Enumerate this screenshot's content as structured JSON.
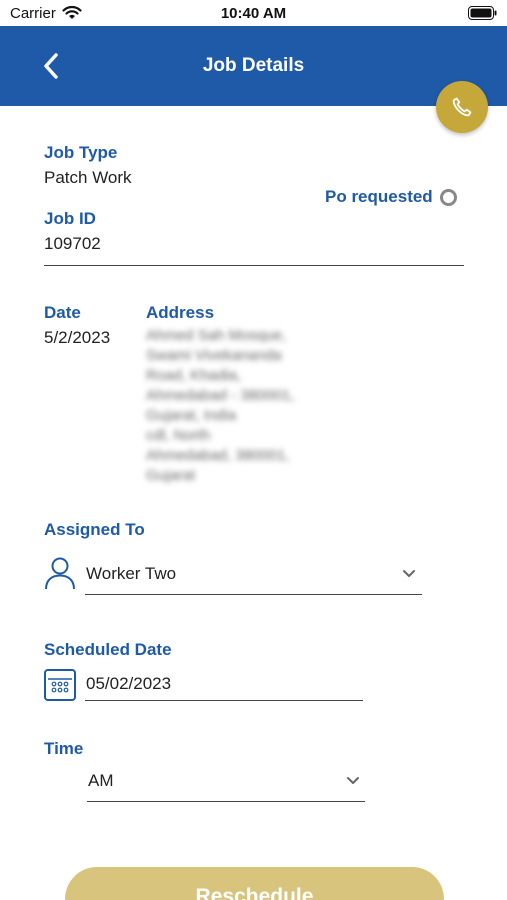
{
  "status_bar": {
    "carrier": "Carrier",
    "time": "10:40 AM"
  },
  "header": {
    "title": "Job Details"
  },
  "job": {
    "type_label": "Job Type",
    "type_value": "Patch Work",
    "id_label": "Job ID",
    "id_value": "109702",
    "po_label": "Po requested",
    "date_label": "Date",
    "date_value": "5/2/2023",
    "address_label": "Address",
    "address_lines": [
      "Ahmed Sah Mosque,",
      "Swami Vivekananda",
      "Road, Khadia,",
      "Ahmedabad - 380001,",
      "Gujarat, India",
      "cdl, North",
      "Ahmedabad, 380001,",
      "Gujarat"
    ]
  },
  "assigned": {
    "label": "Assigned To",
    "value": "Worker Two"
  },
  "scheduled": {
    "label": "Scheduled Date",
    "value": "05/02/2023"
  },
  "time": {
    "label": "Time",
    "value": "AM"
  },
  "actions": {
    "reschedule_label": "Reschedule"
  },
  "colors": {
    "primary": "#1f5aa8",
    "accent_gold": "#c6a739",
    "button_gold": "#d9c47e"
  },
  "icons": [
    "back-arrow-icon",
    "phone-icon",
    "user-icon",
    "calendar-icon",
    "chevron-down-icon",
    "wifi-icon",
    "battery-icon"
  ]
}
